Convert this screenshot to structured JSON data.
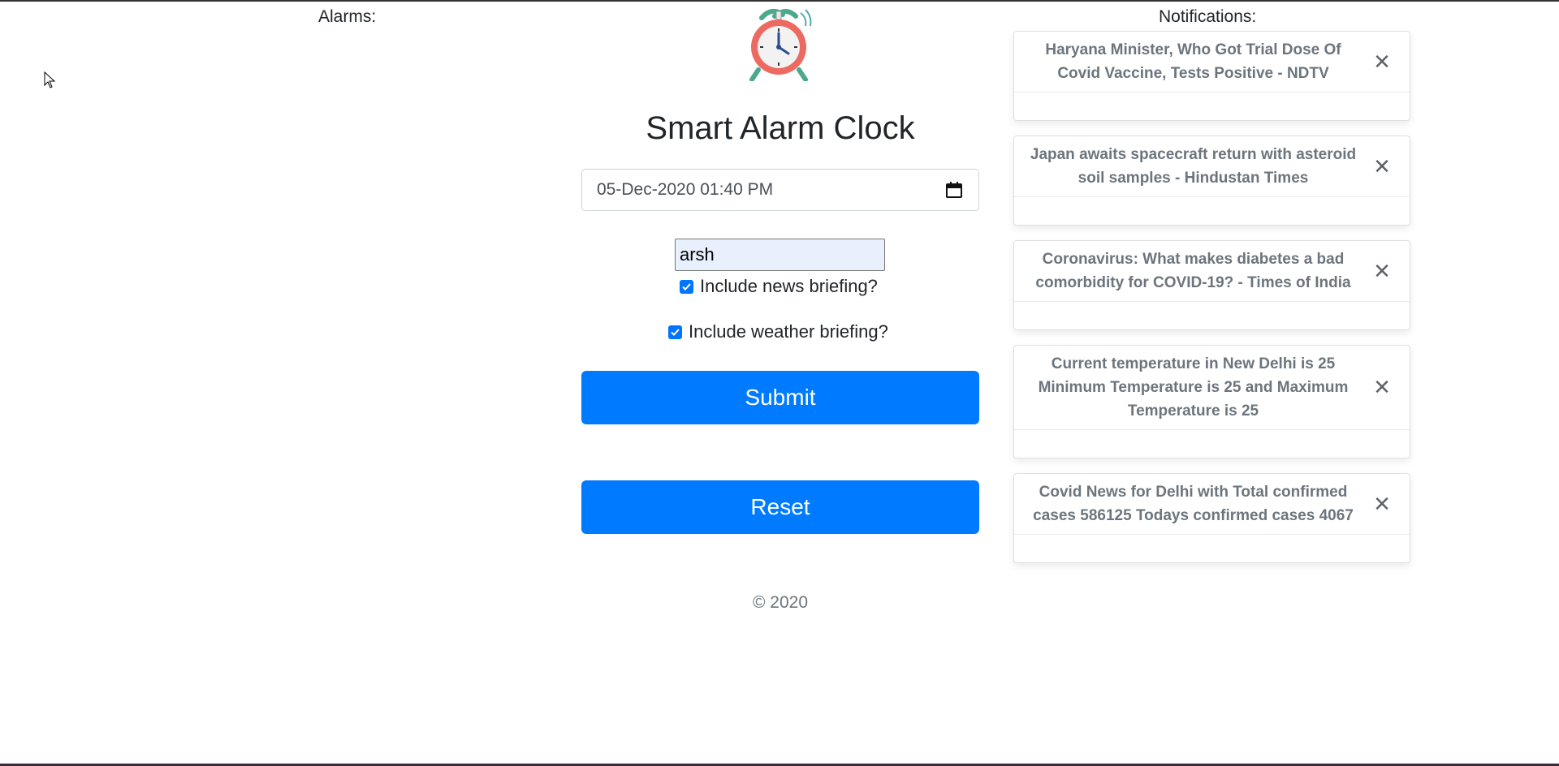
{
  "alarms": {
    "label": "Alarms:"
  },
  "app": {
    "title": "Smart Alarm Clock"
  },
  "form": {
    "datetime_value": "05-Dec-2020 01:40 PM",
    "name_value": "arsh",
    "news_label": "Include news briefing?",
    "news_checked": true,
    "weather_label": "Include weather briefing?",
    "weather_checked": true,
    "submit_label": "Submit",
    "reset_label": "Reset"
  },
  "footer": {
    "copyright": "© 2020"
  },
  "notifications": {
    "label": "Notifications:",
    "items": [
      {
        "title": "Haryana Minister, Who Got Trial Dose Of Covid Vaccine, Tests Positive - NDTV"
      },
      {
        "title": "Japan awaits spacecraft return with asteroid soil samples - Hindustan Times"
      },
      {
        "title": "Coronavirus: What makes diabetes a bad comorbidity for COVID-19? - Times of India"
      },
      {
        "title": "Current temperature in New Delhi is 25 Minimum Temperature is 25 and Maximum Temperature is 25"
      },
      {
        "title": "Covid News for Delhi with Total confirmed cases 586125 Todays confirmed cases 4067"
      }
    ],
    "close_glyph": "✕"
  },
  "colors": {
    "primary": "#007bff",
    "checkbox": "#0075ff",
    "autofill": "#e8f0fe",
    "muted": "#6c757d"
  },
  "icons": {
    "logo": "alarm-clock-icon",
    "calendar": "calendar-icon",
    "cursor": "mouse-cursor-icon",
    "close": "close-icon"
  }
}
